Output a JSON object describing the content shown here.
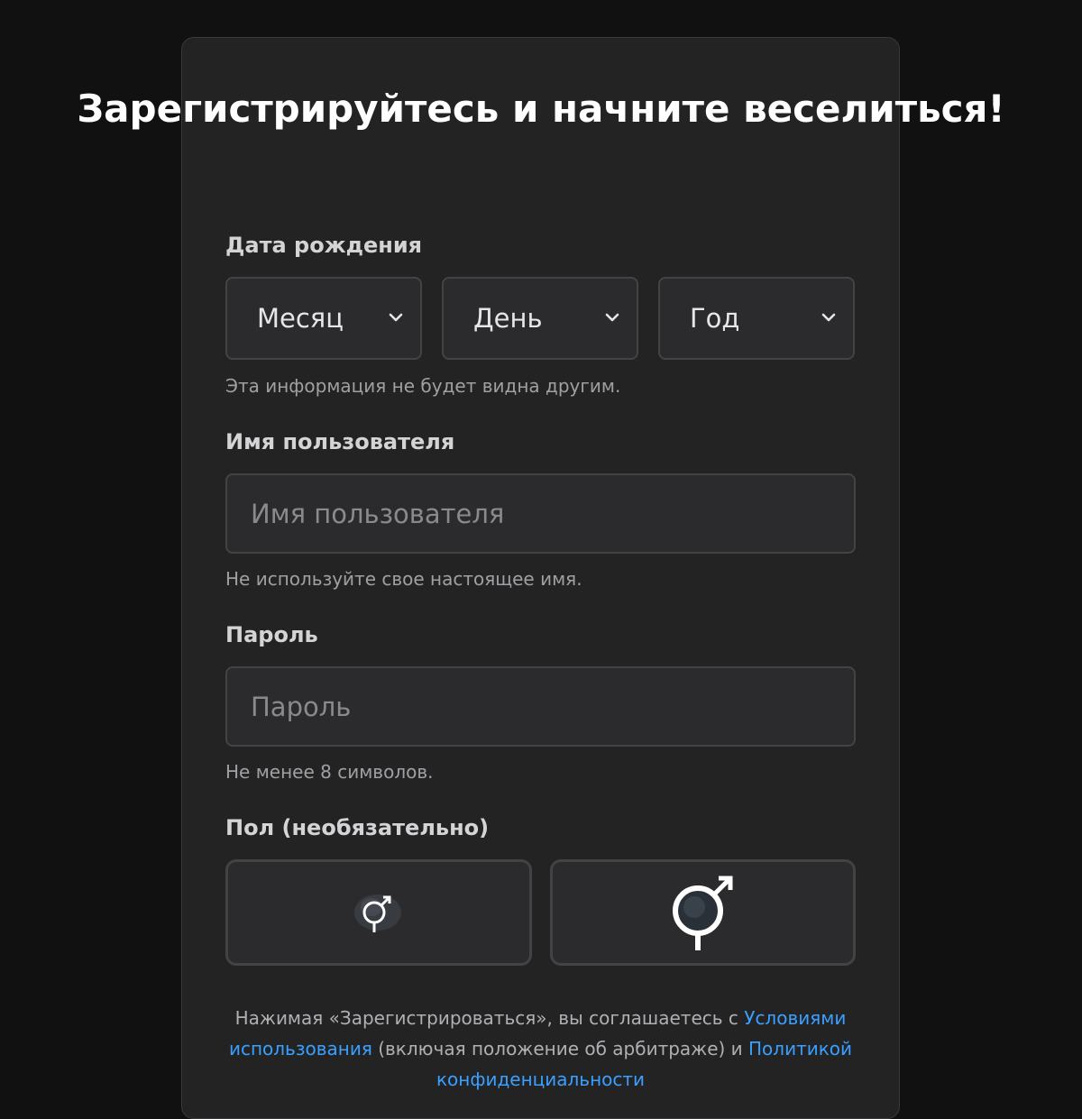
{
  "title": "Зарегистрируйтесь и начните веселиться!",
  "birthday": {
    "label": "Дата рождения",
    "month": "Месяц",
    "day": "День",
    "year": "Год",
    "hint": "Эта информация не будет видна другим."
  },
  "username": {
    "label": "Имя пользователя",
    "placeholder": "Имя пользователя",
    "hint": "Не используйте свое настоящее имя."
  },
  "password": {
    "label": "Пароль",
    "placeholder": "Пароль",
    "hint": "Не менее 8 символов."
  },
  "gender": {
    "label": "Пол (необязательно)",
    "options": [
      "female-icon",
      "male-icon"
    ]
  },
  "terms": {
    "prefix": "Нажимая «Зарегистрироваться», вы соглашаетесь с ",
    "terms_link": "Условиями использования",
    "middle": " (включая положение об арбитраже) и ",
    "privacy_link": "Политикой конфиденциальности"
  },
  "colors": {
    "background": "#111112",
    "card": "#232324",
    "link": "#3aa0ff"
  }
}
